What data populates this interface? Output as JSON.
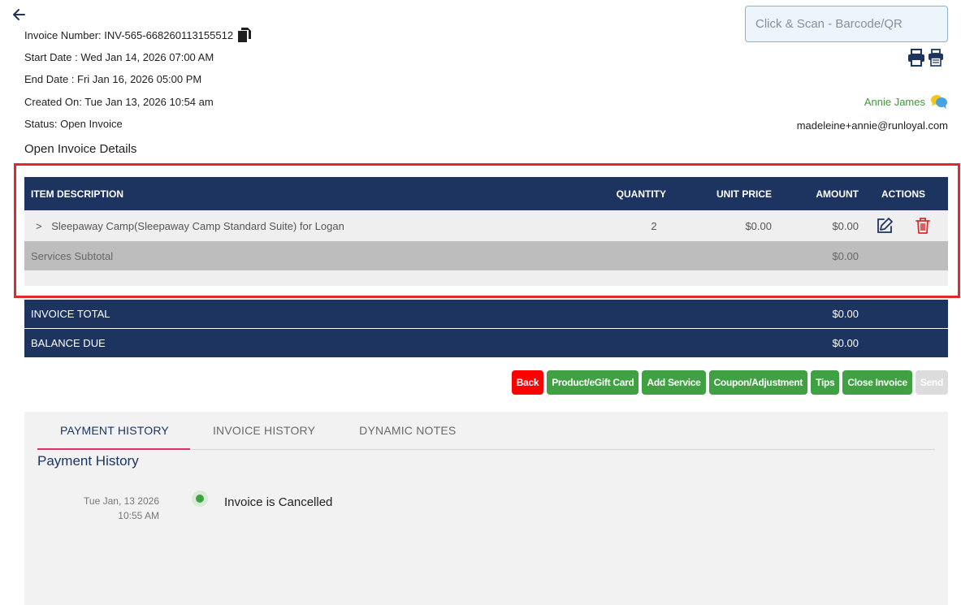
{
  "header": {
    "back_icon": "arrow-left-icon",
    "invoice_number": "Invoice Number: INV-565-668260113155512",
    "copy_icon": "copy-icon",
    "start_date": "Start Date : Wed Jan 14, 2026 07:00 AM",
    "end_date": "End Date : Fri Jan 16, 2026 05:00 PM",
    "created_on": "Created On: Tue Jan 13, 2026 10:54 am",
    "status": "Status: Open Invoice",
    "section_title": "Open Invoice Details"
  },
  "scan": {
    "placeholder": "Click & Scan - Barcode/QR"
  },
  "print": {
    "icons": [
      "print-icon",
      "receipt-print-icon"
    ]
  },
  "user": {
    "name": "Annie James",
    "email": "madeleine+annie@runloyal.com",
    "chat_icon": "chat-bubbles-icon"
  },
  "table": {
    "headers": {
      "description": "ITEM DESCRIPTION",
      "quantity": "QUANTITY",
      "unit_price": "UNIT PRICE",
      "amount": "AMOUNT",
      "actions": "ACTIONS"
    },
    "rows": [
      {
        "expand": ">",
        "description": "Sleepaway Camp(Sleepaway Camp Standard Suite) for Logan",
        "quantity": "2",
        "unit_price": "$0.00",
        "amount": "$0.00"
      }
    ],
    "subtotal": {
      "label": "Services Subtotal",
      "amount": "$0.00"
    }
  },
  "totals": {
    "invoice_total_label": "INVOICE TOTAL",
    "invoice_total": "$0.00",
    "balance_due_label": "BALANCE DUE",
    "balance_due": "$0.00"
  },
  "buttons": {
    "back": "Back",
    "product": "Product/eGift Card",
    "add_service": "Add Service",
    "coupon": "Coupon/Adjustment",
    "tips": "Tips",
    "close_invoice": "Close Invoice",
    "send": "Send"
  },
  "history": {
    "tabs": [
      "PAYMENT HISTORY",
      "INVOICE HISTORY",
      "DYNAMIC NOTES"
    ],
    "active_tab": 0,
    "title": "Payment History",
    "entries": [
      {
        "date": "Tue Jan, 13 2026",
        "time": "10:55 AM",
        "text": "Invoice is Cancelled"
      }
    ]
  },
  "colors": {
    "navy": "#1d3461",
    "green": "#3fa142",
    "red": "#ff0000",
    "highlight": "#e02a2a",
    "tab_accent": "#e0306a"
  }
}
